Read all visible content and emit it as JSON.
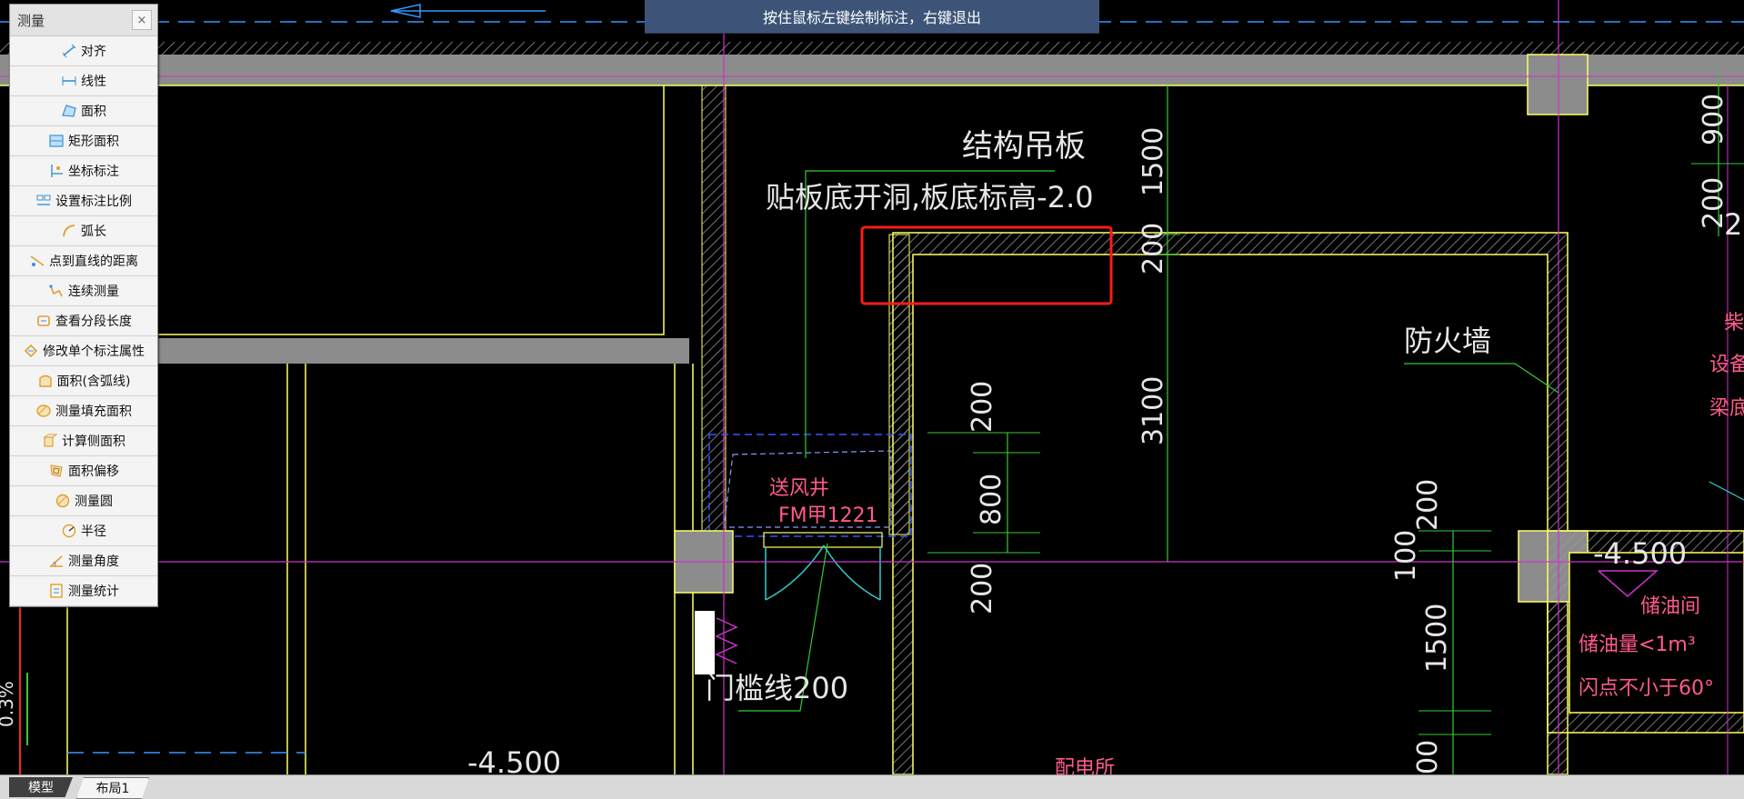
{
  "hint": "按住鼠标左键绘制标注，右键退出",
  "palette": {
    "title": "测量",
    "close": "×",
    "tools": [
      {
        "label": "对齐",
        "icon": "align-dimension-icon"
      },
      {
        "label": "线性",
        "icon": "linear-dimension-icon"
      },
      {
        "label": "面积",
        "icon": "area-icon"
      },
      {
        "label": "矩形面积",
        "icon": "rectangle-area-icon"
      },
      {
        "label": "坐标标注",
        "icon": "coordinate-dimension-icon"
      },
      {
        "label": "设置标注比例",
        "icon": "dimension-scale-icon"
      },
      {
        "label": "弧长",
        "icon": "arc-length-icon"
      },
      {
        "label": "点到直线的距离",
        "icon": "point-to-line-icon"
      },
      {
        "label": "连续测量",
        "icon": "continuous-measure-icon"
      },
      {
        "label": "查看分段长度",
        "icon": "segment-length-icon"
      },
      {
        "label": "修改单个标注属性",
        "icon": "edit-dimension-icon"
      },
      {
        "label": "面积(含弧线)",
        "icon": "area-with-arc-icon"
      },
      {
        "label": "测量填充面积",
        "icon": "hatch-area-icon"
      },
      {
        "label": "计算侧面积",
        "icon": "side-area-icon"
      },
      {
        "label": "面积偏移",
        "icon": "area-offset-icon"
      },
      {
        "label": "测量圆",
        "icon": "measure-circle-icon"
      },
      {
        "label": "半径",
        "icon": "radius-icon"
      },
      {
        "label": "测量角度",
        "icon": "measure-angle-icon"
      },
      {
        "label": "测量统计",
        "icon": "measure-statistics-icon"
      }
    ]
  },
  "drawing": {
    "labels": {
      "structural_ceiling": "结构吊板",
      "opening_note": "贴板底开洞,板底标高-2.0",
      "firewall": "防火墙",
      "air_shaft": "送风井",
      "door_code": "FM甲1221",
      "threshold": "门槛线200",
      "level_left": "-4.500",
      "level_right": "-4.500",
      "oil_room": "储油间",
      "oil_capacity": "储油量<1m³",
      "flash_point": "闪点不小于60°",
      "power_room": "配电所",
      "edge_1": "柴",
      "edge_2": "设备",
      "edge_3": "梁底",
      "edge_4": "2",
      "edge_left": "0.3%"
    },
    "dimensions": {
      "d1500_top": "1500",
      "d200_top": "200",
      "d3100": "3100",
      "d200_a": "200",
      "d800": "800",
      "d200_b": "200",
      "d200_c": "200",
      "d100": "100",
      "d1500_bottom": "1500",
      "d00": "00",
      "d900": "900",
      "d200_right": "200"
    }
  },
  "tabs": {
    "model": "模型",
    "layout1": "布局1"
  },
  "colors": {
    "wall": "#ffff66",
    "dimension": "#33cc33",
    "axis": "#cc33cc",
    "tag": "#ff5a8a",
    "highlight": "#ff1a1a",
    "wall_fill": "#8c8c8c"
  }
}
